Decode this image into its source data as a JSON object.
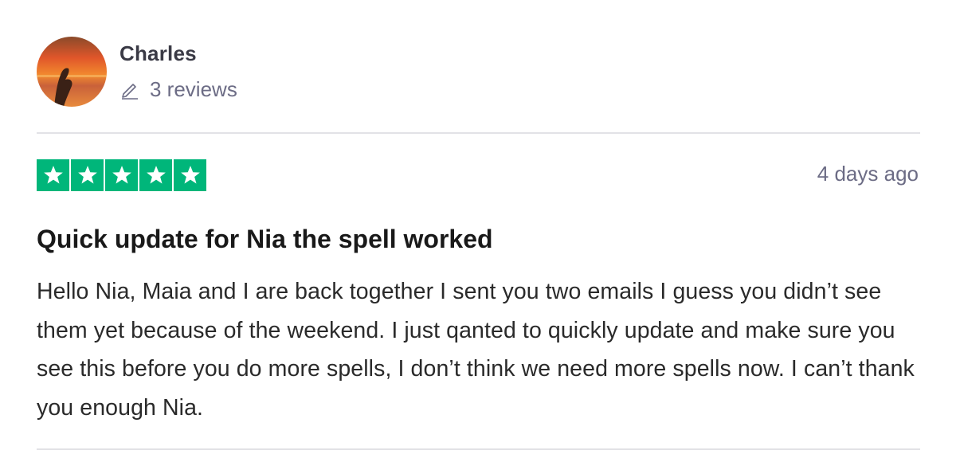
{
  "reviewer": {
    "name": "Charles",
    "review_count": "3 reviews",
    "avatar_icon": "sunset-photo-avatar"
  },
  "review": {
    "rating": 5,
    "rating_max": 5,
    "star_color": "#00b67a",
    "date": "4 days ago",
    "title": "Quick update for Nia the spell worked",
    "body": "Hello Nia, Maia and I are back together I sent you two emails I guess you didn’t see them yet because of the weekend. I just qanted to quickly update and make sure you see this before you do more spells, I don’t think we need more spells now. I can’t thank you enough Nia."
  },
  "icons": {
    "pencil": "pencil-icon",
    "star": "star-icon"
  }
}
